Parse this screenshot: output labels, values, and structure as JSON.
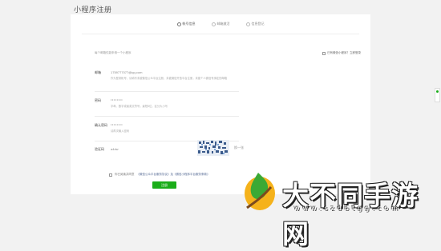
{
  "page": {
    "title": "小程序注册"
  },
  "steps": [
    {
      "label": "帐号信息",
      "active": true
    },
    {
      "label": "邮箱激活",
      "active": false
    },
    {
      "label": "信息登记",
      "active": false
    }
  ],
  "form": {
    "intro": "每个邮箱仅能申请一个小程序",
    "login_link": "已有微信小程序？立即登录",
    "email": {
      "label": "邮箱",
      "value": "1759777077@qq.com",
      "hint": "作为登录帐号，请填写未被微信公众平台注册，未被微信开放平台注册，未被个人微信号绑定的邮箱"
    },
    "password": {
      "label": "密码",
      "value": "••••••••",
      "hint": "字母、数字或者英文符号，最短8位，区分大小写"
    },
    "confirm_password": {
      "label": "确认密码",
      "value": "••••••••",
      "hint": "请再次输入密码"
    },
    "captcha": {
      "label": "验证码",
      "value": "a4dw",
      "refresh": "换一张"
    },
    "agreement": {
      "prefix": "你已阅读并同意",
      "link": "《微信公众平台服务协议》及《微信小程序平台服务条款》"
    },
    "submit_label": "注册"
  },
  "watermark": {
    "text": "大不同手游网",
    "url": "www.szdbtgg.com"
  },
  "colors": {
    "accent": "#1aad19",
    "background": "#f2f2f2",
    "link": "#576b95"
  }
}
